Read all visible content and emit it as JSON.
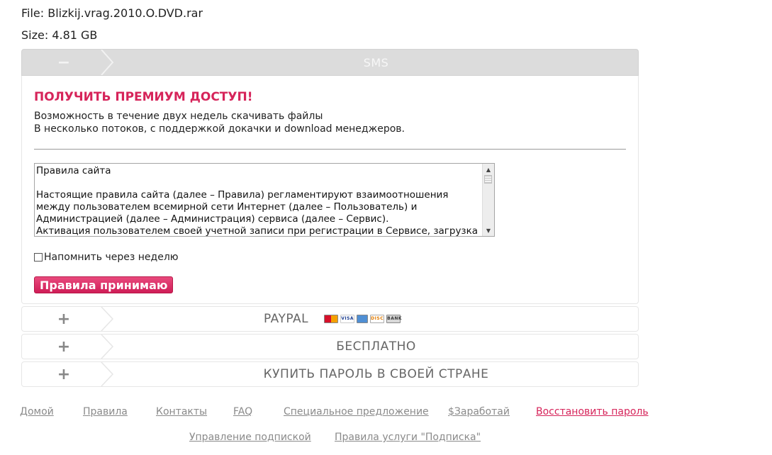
{
  "file": {
    "name": "File: Blizkij.vrag.2010.O.DVD.rar",
    "size": "Size: 4.81 GB"
  },
  "sms": {
    "toggle": "−",
    "title": "SMS",
    "promo_title": "ПОЛУЧИТЬ ПРЕМИУМ ДОСТУП!",
    "promo_line1": "Возможность в течение двух недель скачивать файлы",
    "promo_line2": "В несколько потоков, с поддержкой докачки и download менеджеров.",
    "rules_text": "Правила сайта\n\nНастоящие правила сайта (далее – Правила) регламентируют взаимоотношения между пользователем всемирной сети Интернет (далее – Пользователь) и Администрацией (далее – Администрация) сервиса  (далее – Сервис).\nАктивация пользователем своей учетной записи при регистрации в Сервисе, загрузка",
    "remind_label": "Напомнить через неделю",
    "accept_button": "Правила принимаю"
  },
  "paypal": {
    "toggle": "+",
    "title": "PAYPAL",
    "card_icons": [
      "mastercard-icon",
      "visa-icon",
      "amex-icon",
      "discover-icon",
      "bank-icon"
    ]
  },
  "free": {
    "toggle": "+",
    "title": "БЕСПЛАТНО"
  },
  "country": {
    "toggle": "+",
    "title": "КУПИТЬ ПАРОЛЬ В СВОЕЙ СТРАНЕ"
  },
  "footer": {
    "row1": [
      "Домой",
      "Правила",
      "Контакты",
      "FAQ",
      "Специальное предложение",
      "$Заработай",
      "Восстановить пароль"
    ],
    "row2": [
      "Управление подпиской",
      "Правила услуги \"Подписка\""
    ]
  },
  "colors": {
    "accent": "#d6245a",
    "header_active": "#dcdcdc",
    "link": "#8a8a8a"
  }
}
